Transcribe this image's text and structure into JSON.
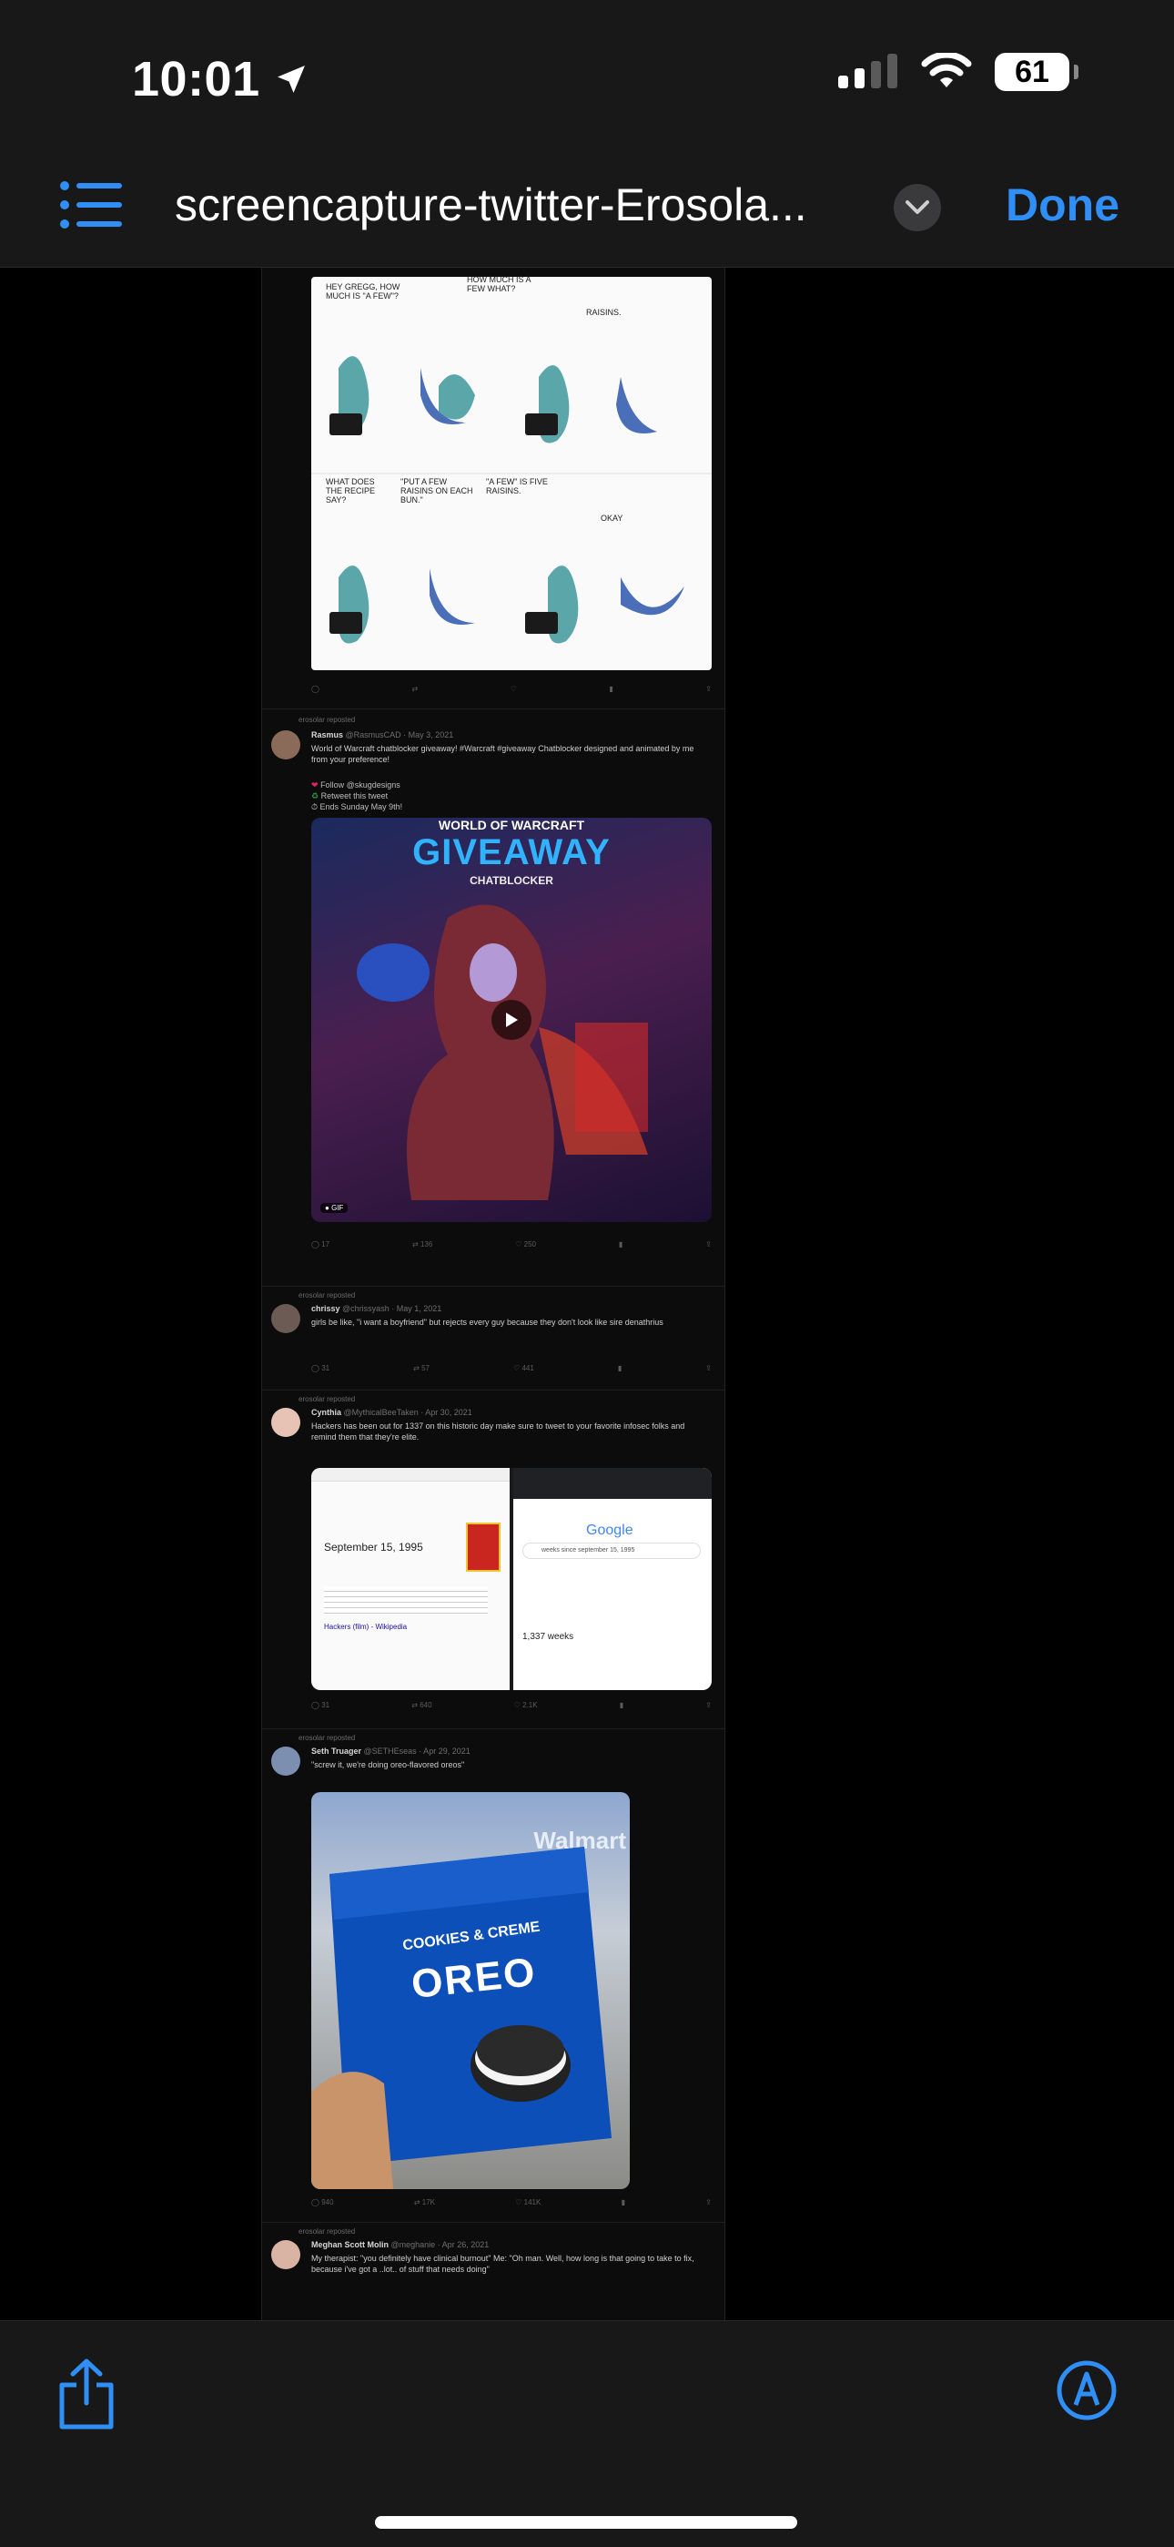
{
  "status_bar": {
    "time": "10:01",
    "battery": "61"
  },
  "nav": {
    "title": "screencapture-twitter-Erosola...",
    "done_label": "Done"
  },
  "tweets": [
    {
      "comic_text": [
        "HEY GREGG, HOW MUCH IS \"A FEW\"?",
        "HOW MUCH IS A FEW WHAT?",
        "RAISINS.",
        "WHAT DOES THE RECIPE SAY?",
        "\"PUT A FEW RAISINS ON EACH BUN.\"",
        "\"A FEW\" IS FIVE RAISINS.",
        "OKAY"
      ]
    },
    {
      "repost": "erosolar reposted",
      "author": "Rasmus",
      "handle": "@RasmusCAD · May 3, 2021",
      "text": "World of Warcraft chatblocker giveaway! #Warcraft #giveaway Chatblocker designed and animated by me from your preference!",
      "list": [
        "Follow @skugdesigns",
        "Retweet this tweet",
        "Ends Sunday May 9th!"
      ],
      "media_title_small": "WORLD OF WARCRAFT",
      "media_title": "GIVEAWAY",
      "media_subtitle": "CHATBLOCKER",
      "media_badge": "GIF",
      "stats": [
        "17",
        "136",
        "250"
      ]
    },
    {
      "repost": "erosolar reposted",
      "author": "chrissy",
      "handle": "@chrissyash · May 1, 2021",
      "text": "girls be like, \"i want a boyfriend\" but rejects every guy because they don't look like sire denathrius",
      "stats": [
        "31",
        "57",
        "441"
      ]
    },
    {
      "repost": "erosolar reposted",
      "author": "Cynthia",
      "handle": "@MythicalBeeTaken · Apr 30, 2021",
      "text": "Hackers has been out for 1337 on this historic day make sure to tweet to your favorite infosec folks and remind them that they're elite.",
      "left_heading": "September 15, 1995",
      "left_link": "Hackers (film) - Wikipedia",
      "right_logo": "Google",
      "right_query": "weeks since september 15, 1995",
      "right_result": "1,337 weeks",
      "stats": [
        "31",
        "640",
        "2.1K"
      ]
    },
    {
      "repost": "erosolar reposted",
      "author": "Seth Truager",
      "handle": "@SETHEseas · Apr 29, 2021",
      "text": "\"screw it, we're doing oreo-flavored oreos\"",
      "media_store": "Walmart",
      "media_brand": "OREO",
      "media_flavor": "COOKIES & CREME",
      "stats": [
        "940",
        "17K",
        "141K"
      ]
    },
    {
      "repost": "erosolar reposted",
      "author": "Meghan Scott Molin",
      "handle": "@meghanie · Apr 26, 2021",
      "text": "My therapist: \"you definitely have clinical burnout\" Me: \"Oh man. Well, how long is that going to take to fix, because i've got a ..lot.. of stuff that needs doing\""
    }
  ],
  "toolbar": {
    "share": "share-icon",
    "markup": "markup-icon"
  }
}
